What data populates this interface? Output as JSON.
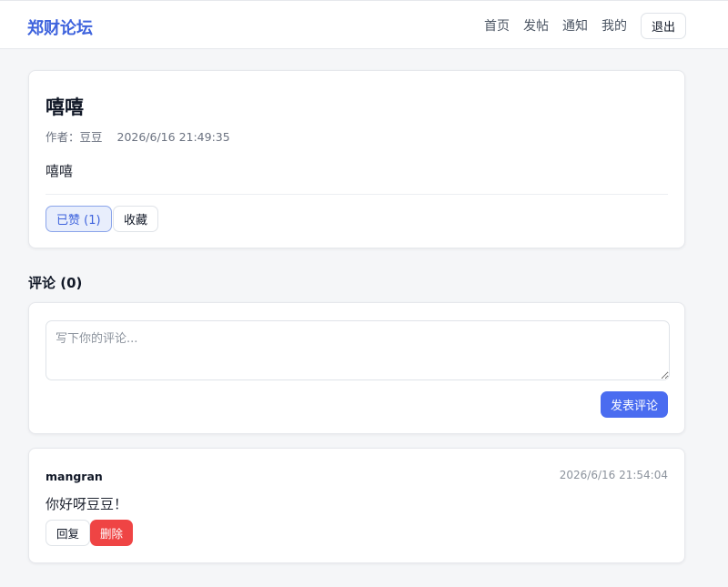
{
  "header": {
    "brand": "郑财论坛",
    "nav": [
      "首页",
      "发帖",
      "通知",
      "我的"
    ],
    "logout_label": "退出"
  },
  "post": {
    "title": "嘻嘻",
    "author_label": "作者：豆豆",
    "timestamp": "2026/6/16 21:49:35",
    "body": "嘻嘻",
    "like_label": "已赞 (1)",
    "favorite_label": "收藏"
  },
  "comments_section": {
    "title": "评论 (0)",
    "input_placeholder": "写下你的评论...",
    "input_value": "",
    "submit_label": "发表评论"
  },
  "comments": [
    {
      "author": "mangran",
      "timestamp": "2026/6/16 21:54:04",
      "body": "你好呀豆豆！",
      "reply_label": "回复",
      "delete_label": "删除"
    }
  ],
  "colors": {
    "brand": "#3e63dd",
    "primary_button": "#4a6cf0",
    "danger_button": "#ef4444",
    "liked_bg": "#e8eefc"
  }
}
